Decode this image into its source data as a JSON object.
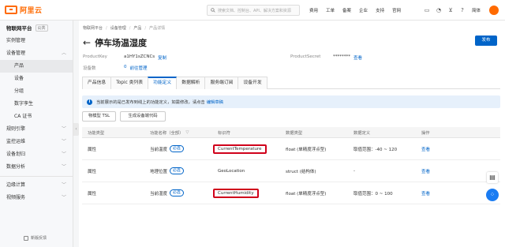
{
  "topbar": {
    "logo_text": "阿里云",
    "search_placeholder": "搜索文档、控制台、API、解决方案和资源",
    "links": [
      "费用",
      "工单",
      "备案",
      "企业",
      "支持",
      "官网"
    ],
    "icons": [
      "terminal-icon",
      "bell-icon",
      "cart-icon",
      "help-icon"
    ],
    "language": "简体"
  },
  "sidebar": {
    "title": "物联网平台",
    "tag": "公共",
    "items": [
      {
        "label": "实例管理",
        "sub": false
      },
      {
        "label": "设备管理",
        "sub": false,
        "chevron": "^"
      },
      {
        "label": "产品",
        "sub": true,
        "active": true
      },
      {
        "label": "设备",
        "sub": true
      },
      {
        "label": "分组",
        "sub": true
      },
      {
        "label": "数字孪生",
        "sub": true
      },
      {
        "label": "CA 证书",
        "sub": true
      }
    ],
    "items2": [
      {
        "label": "规则引擎",
        "chevron": "v"
      },
      {
        "label": "监控运维",
        "chevron": "v"
      },
      {
        "label": "设备划归",
        "chevron": "v"
      },
      {
        "label": "数据分析",
        "chevron": "v"
      }
    ],
    "items3": [
      {
        "label": "边缘计算",
        "chevron": "v"
      },
      {
        "label": "视频服务",
        "chevron": "v"
      }
    ],
    "feedback": "新版反馈"
  },
  "breadcrumb": [
    "物联网平台",
    "设备管理",
    "产品",
    "产品详情"
  ],
  "page_title": "停车场温湿度",
  "publish_label": "发布",
  "info": {
    "product_key_label": "ProductKey",
    "product_key_value": "a1HY1sZCNCs",
    "copy_label": "复制",
    "product_secret_label": "ProductSecret",
    "product_secret_value": "********",
    "view_label": "查看",
    "device_count_label": "设备数",
    "device_count_value": "0",
    "goto_manage_label": "前往管理"
  },
  "tabs": [
    "产品信息",
    "Topic 类列表",
    "功能定义",
    "数据解析",
    "服务端订阅",
    "设备开发"
  ],
  "active_tab": 2,
  "alert": {
    "text": "当前展示的是已发布到线上的功能定义，如需修改，请点击",
    "link": "编辑草稿"
  },
  "buttons": {
    "tsl": "物模型 TSL",
    "gen_code": "生成设备端代码"
  },
  "table": {
    "headers": [
      "功能类型",
      "功能名称（全部）",
      "标识符",
      "数据类型",
      "数据定义",
      "操作"
    ],
    "rows": [
      {
        "type": "属性",
        "name": "当前温度",
        "required": "必选",
        "identifier": "CurrentTemperature",
        "data_type": "float (单精度浮点型)",
        "definition": "取值范围：-40 ~ 120",
        "action": "查看",
        "highlight": true
      },
      {
        "type": "属性",
        "name": "地理位置",
        "required": "必选",
        "identifier": "GeoLocation",
        "data_type": "struct (结构体)",
        "definition": "-",
        "action": "查看",
        "highlight": false
      },
      {
        "type": "属性",
        "name": "当前湿度",
        "required": "必选",
        "identifier": "CurrentHumidity",
        "data_type": "float (单精度浮点型)",
        "definition": "取值范围：0 ~ 100",
        "action": "查看",
        "highlight": true
      }
    ]
  },
  "colors": {
    "brand": "#ff6a00",
    "primary": "#0064c8",
    "highlight": "#d0021b"
  }
}
